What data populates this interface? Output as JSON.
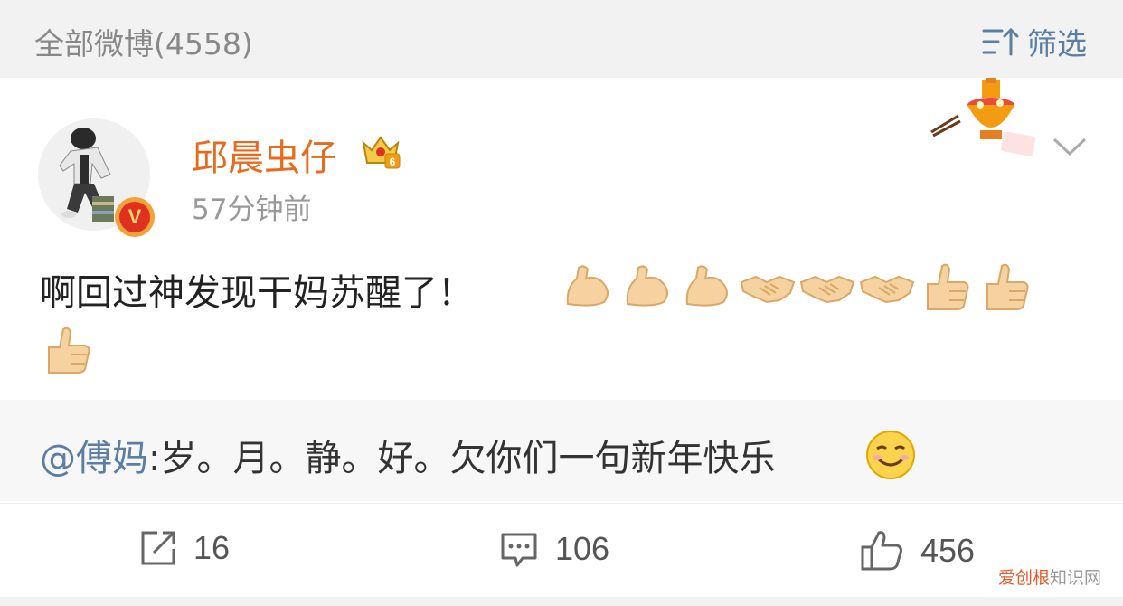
{
  "header": {
    "title": "全部微博(4558)",
    "filter_label": "筛选",
    "filter_icon": "filter-sort-icon"
  },
  "post": {
    "username": "邱晨虫仔",
    "level_badge": "6",
    "verified_badge": "V",
    "time": "57分钟前",
    "text": "啊回过神发现干妈苏醒了！",
    "emojis": [
      "muscle",
      "muscle",
      "muscle",
      "handshake",
      "handshake",
      "handshake",
      "thumbs-up",
      "thumbs-up",
      "thumbs-up"
    ]
  },
  "repost": {
    "mention": "@傅妈",
    "text": ":岁。月。静。好。欠你们一句新年快乐",
    "emoji": "smile"
  },
  "actions": {
    "share_count": "16",
    "comment_count": "106",
    "like_count": "456"
  },
  "watermark": {
    "part1": "爱创根",
    "part2": "知识网"
  },
  "colors": {
    "accent": "#e86a1c",
    "link": "#5b7ea4",
    "topbar": "#f2f2f2"
  }
}
